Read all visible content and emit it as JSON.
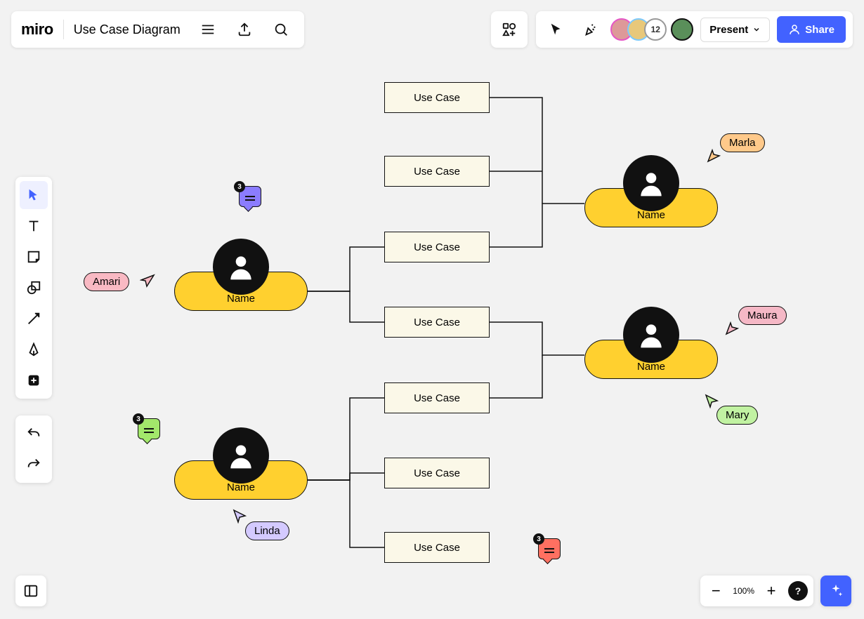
{
  "app": {
    "logo": "miro",
    "board_title": "Use Case Diagram"
  },
  "header": {
    "present_label": "Present",
    "share_label": "Share",
    "avatar_count": "12"
  },
  "toolbar": {
    "tools": [
      "select",
      "text",
      "sticky",
      "shape",
      "line",
      "pen",
      "more"
    ],
    "history": [
      "undo",
      "redo"
    ]
  },
  "zoom": {
    "level": "100%"
  },
  "actors": [
    {
      "label": "Name"
    },
    {
      "label": "Name"
    },
    {
      "label": "Name"
    },
    {
      "label": "Name"
    }
  ],
  "usecases": [
    {
      "label": "Use Case"
    },
    {
      "label": "Use Case"
    },
    {
      "label": "Use Case"
    },
    {
      "label": "Use Case"
    },
    {
      "label": "Use Case"
    },
    {
      "label": "Use Case"
    },
    {
      "label": "Use Case"
    }
  ],
  "comments": [
    {
      "count": "3",
      "color": "#8b7cff"
    },
    {
      "count": "3",
      "color": "#a3e86b"
    },
    {
      "count": "3",
      "color": "#ff7061"
    }
  ],
  "cursors": [
    {
      "name": "Amari",
      "color": "#f9b9c3"
    },
    {
      "name": "Linda",
      "color": "#d4caff"
    },
    {
      "name": "Marla",
      "color": "#ffc98a"
    },
    {
      "name": "Maura",
      "color": "#f5b8c6"
    },
    {
      "name": "Mary",
      "color": "#c1f2a2"
    }
  ]
}
